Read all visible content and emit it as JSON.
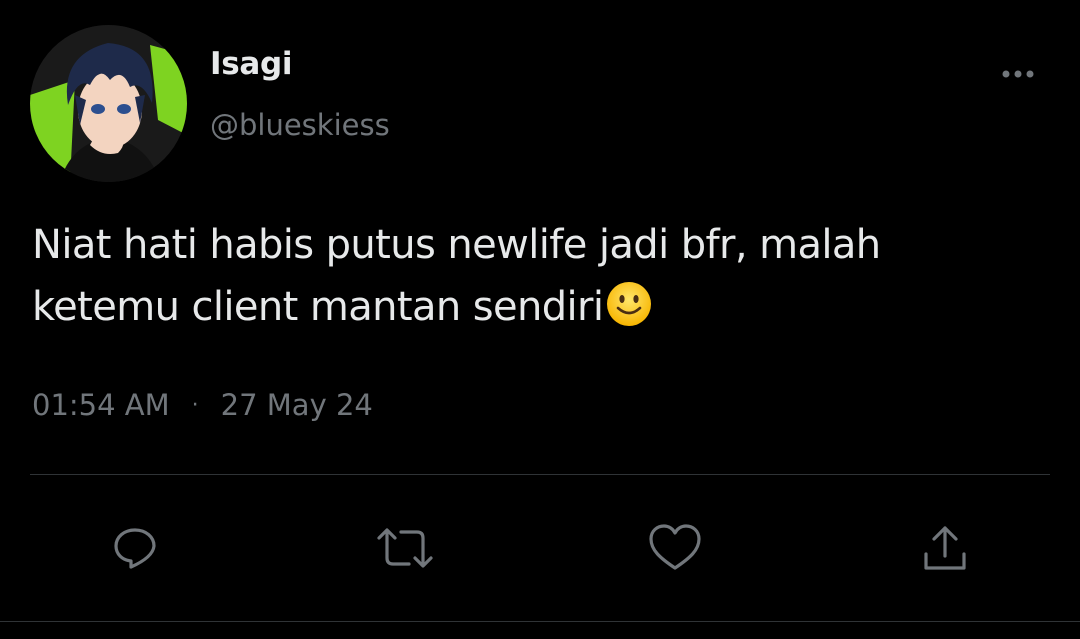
{
  "user": {
    "display_name": "Isagi",
    "handle": "@blueskiess"
  },
  "tweet": {
    "text": "Niat hati habis putus newlife jadi bfr, malah ketemu client mantan sendiri",
    "emoji": "slightly-smiling-face",
    "time": "01:54 AM",
    "separator": "·",
    "date": "27 May 24"
  },
  "icons": {
    "more": "more-icon",
    "reply": "reply-icon",
    "retweet": "retweet-icon",
    "like": "heart-icon",
    "share": "share-icon"
  },
  "colors": {
    "background": "#000000",
    "text_primary": "#e7e9ea",
    "text_secondary": "#71767b",
    "divider": "#2f3336",
    "avatar_accent": "#7ed321"
  }
}
